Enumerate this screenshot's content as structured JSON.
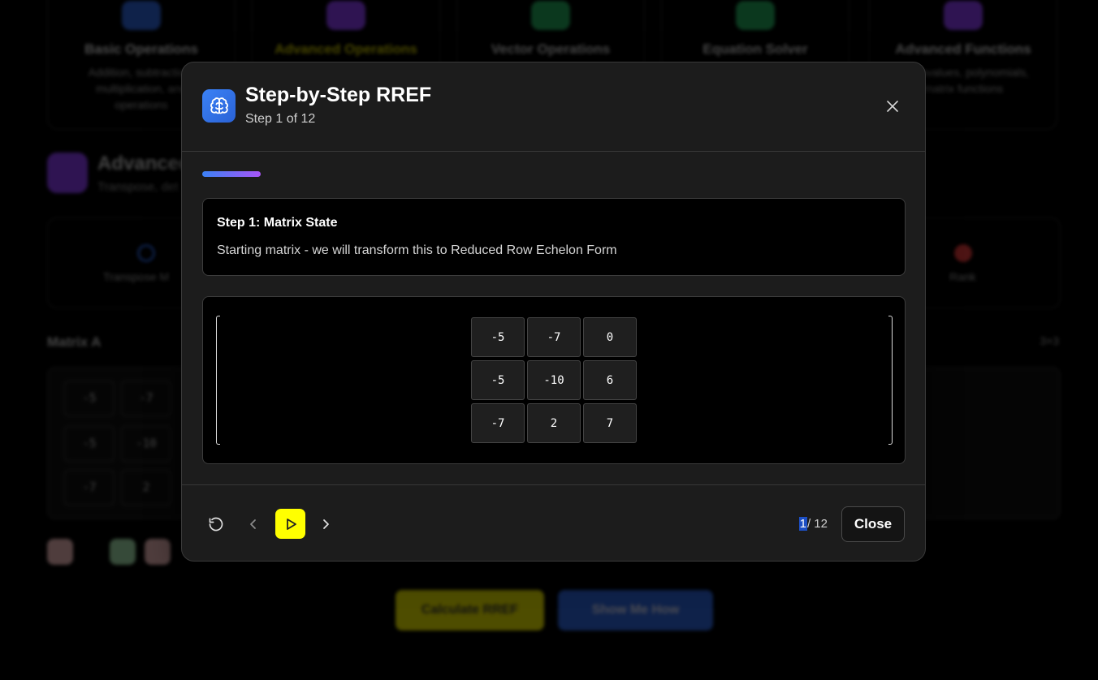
{
  "background": {
    "operation_cards": [
      {
        "title": "Basic Operations",
        "desc": "Addition, subtraction, multiplication, and operations",
        "accent": "#2d63d8"
      },
      {
        "title": "Advanced Operations",
        "desc": "",
        "accent": "#8a3df0"
      },
      {
        "title": "Vector Operations",
        "desc": "",
        "accent": "#22a55a"
      },
      {
        "title": "Equation Solver",
        "desc": "",
        "accent": "#22a55a"
      },
      {
        "title": "Advanced Functions",
        "desc": "Eigenvalues, polynomials, matrix functions",
        "accent": "#8a3df0"
      }
    ],
    "section_title": "Advanced",
    "section_subtitle": "Transpose, det",
    "functions": [
      {
        "label": "Transpose M",
        "accent": "#2d63d8"
      },
      {
        "label": "Rank",
        "accent": "#e23b3b"
      }
    ],
    "matrix_label": "Matrix A",
    "matrix_size": "3×3",
    "matrix": [
      [
        "-5",
        "-7"
      ],
      [
        "-5",
        "-10"
      ],
      [
        "-7",
        "2"
      ]
    ],
    "cta_primary": "Calculate RREF",
    "cta_secondary": "Show Me How"
  },
  "modal": {
    "title": "Step-by-Step RREF",
    "subtitle": "Step 1 of 12",
    "progress": 0.083,
    "step_title": "Step 1: Matrix State",
    "step_description": "Starting matrix - we will transform this to Reduced Row Echelon Form",
    "matrix": [
      [
        "-5",
        "-7",
        "0"
      ],
      [
        "-5",
        "-10",
        "6"
      ],
      [
        "-7",
        "2",
        "7"
      ]
    ],
    "counter_current": "1",
    "counter_total": "/ 12",
    "close_label": "Close",
    "colors": {
      "accent_blue": "#3b82f6",
      "accent_purple": "#a855f7",
      "play_yellow": "#ffff00"
    },
    "icons": {
      "header": "brain-icon",
      "close": "close-icon",
      "reset": "reset-icon",
      "prev": "chevron-left-icon",
      "play": "play-icon",
      "next": "chevron-right-icon"
    }
  }
}
